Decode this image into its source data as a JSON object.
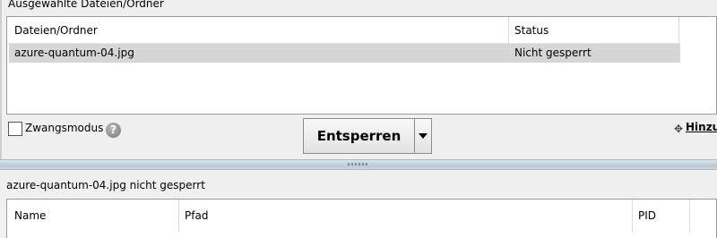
{
  "top": {
    "section_title": "Ausgewählte Dateien/Ordner",
    "columns": {
      "name": "Dateien/Ordner",
      "status": "Status"
    },
    "rows": [
      {
        "name": "azure-quantum-04.jpg",
        "status": "Nicht gesperrt",
        "selected": true
      }
    ]
  },
  "controls": {
    "force_mode_label": "Zwangsmodus",
    "force_mode_checked": false,
    "help_icon": "help-icon",
    "unlock_button": "Entsperren",
    "dropdown_icon": "chevron-down-icon",
    "add_icon": "add-icon",
    "add_link": "Hinzu"
  },
  "bottom": {
    "status_text": "azure-quantum-04.jpg nicht gesperrt",
    "columns": {
      "name": "Name",
      "path": "Pfad",
      "pid": "PID"
    }
  },
  "colors": {
    "selected_row": "#d6d6d6",
    "splitter": "#c9d7e2",
    "background": "#f0f0f0"
  }
}
